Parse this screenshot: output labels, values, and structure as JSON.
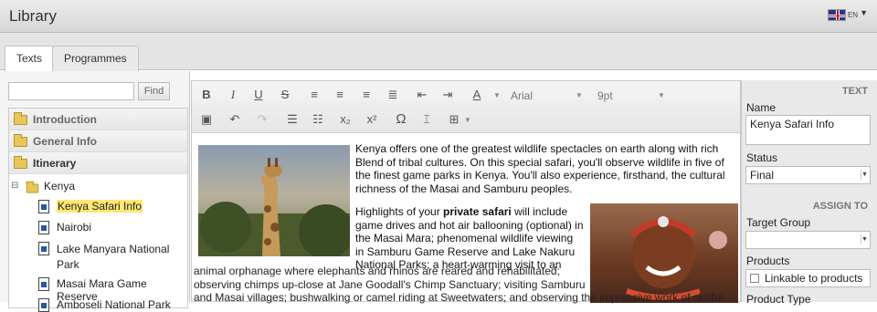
{
  "app": {
    "title": "Library",
    "language": "EN"
  },
  "tabs": [
    {
      "label": "Texts"
    },
    {
      "label": "Programmes"
    }
  ],
  "search": {
    "value": "",
    "button": "Find"
  },
  "tree": {
    "folders": [
      "Introduction",
      "General Info",
      "Itinerary"
    ],
    "kenya": "Kenya",
    "items": [
      "Kenya Safari Info",
      "Nairobi",
      "Lake Manyara National Park",
      "Masai Mara Game Reserve",
      "Amboseli National Park"
    ]
  },
  "toolbar": {
    "font": "Arial",
    "size": "9pt"
  },
  "content": {
    "p1": "Kenya offers one of the greatest wildlife spectacles on earth along with rich Blend of tribal cultures. On this special safari, you'll observe wildlife in five of the finest game parks in Kenya. You'll also experience, firsthand, the cultural richness of the Masai and Samburu peoples.",
    "p2_before": "Highlights of your ",
    "p2_bold": "private safari",
    "p2_after": " will include game drives and hot air ballooning (optional) in the Masai Mara; phenomenal wildlife viewing in Samburu Game Reserve and Lake Nakuru National Parks; a heart-warming visit to an",
    "p2_line2": "animal orphanage where elephants and rhinos are reared and rehabilitated;",
    "p2_line3": "observing chimps up-close at Jane Goodall's Chimp Sanctuary; visiting Samburu",
    "p2_line4": "and Masai villages; bushwalking or camel riding at Sweetwaters; and observing the impressive work of skillful"
  },
  "panel": {
    "text_header": "TEXT",
    "name_label": "Name",
    "name_value": "Kenya Safari Info",
    "status_label": "Status",
    "status_value": "Final",
    "assign_header": "ASSIGN TO",
    "target_label": "Target Group",
    "target_value": "",
    "products_label": "Products",
    "linkable_label": "Linkable to products",
    "product_type_label": "Product Type"
  }
}
